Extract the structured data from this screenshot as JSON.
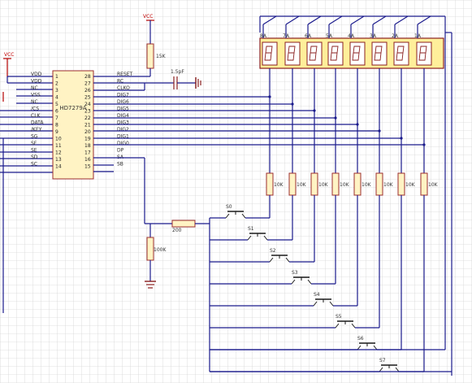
{
  "chip": {
    "name": "HD7279A",
    "left_pins": [
      {
        "num": "1",
        "name": "VDD"
      },
      {
        "num": "2",
        "name": "VDD"
      },
      {
        "num": "3",
        "name": "NC"
      },
      {
        "num": "4",
        "name": "VSS"
      },
      {
        "num": "5",
        "name": "NC"
      },
      {
        "num": "6",
        "name": "/CS"
      },
      {
        "num": "7",
        "name": "CLK"
      },
      {
        "num": "8",
        "name": "DATA"
      },
      {
        "num": "9",
        "name": "/KEY"
      },
      {
        "num": "10",
        "name": "SG"
      },
      {
        "num": "11",
        "name": "SF"
      },
      {
        "num": "12",
        "name": "SE"
      },
      {
        "num": "13",
        "name": "SD"
      },
      {
        "num": "14",
        "name": "SC"
      }
    ],
    "right_pins": [
      {
        "num": "28",
        "name": "RESET"
      },
      {
        "num": "27",
        "name": "RC"
      },
      {
        "num": "26",
        "name": "CLKO"
      },
      {
        "num": "25",
        "name": "DIG7"
      },
      {
        "num": "24",
        "name": "DIG6"
      },
      {
        "num": "23",
        "name": "DIG5"
      },
      {
        "num": "22",
        "name": "DIG4"
      },
      {
        "num": "21",
        "name": "DIG3"
      },
      {
        "num": "20",
        "name": "DIG2"
      },
      {
        "num": "19",
        "name": "DIG1"
      },
      {
        "num": "18",
        "name": "DIG0"
      },
      {
        "num": "17",
        "name": "DP"
      },
      {
        "num": "16",
        "name": "SA"
      },
      {
        "num": "15",
        "name": "SB"
      }
    ]
  },
  "power": {
    "vcc_left": "VCC",
    "vcc_top": "VCC"
  },
  "parts": {
    "r_reset": "15K",
    "c_clk": "1.5pF",
    "r_series": "200",
    "r_pulldown": "100K",
    "digit_resistor": "10K"
  },
  "display_labels": [
    "8A",
    "7A",
    "6A",
    "5A",
    "4A",
    "3A",
    "2A",
    "1A"
  ],
  "keys": [
    "S0",
    "S1",
    "S2",
    "S3",
    "S4",
    "S5",
    "S6",
    "S7"
  ]
}
